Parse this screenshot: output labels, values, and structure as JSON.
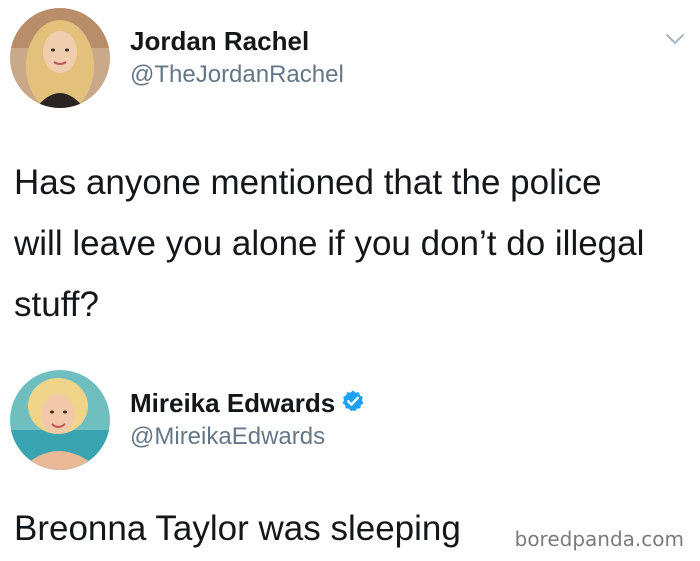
{
  "tweet": {
    "author": {
      "display_name": "Jordan Rachel",
      "handle": "@TheJordanRachel",
      "avatar_icon": "avatar-photo-blonde-woman"
    },
    "text": "Has anyone mentioned that the police will leave you alone if you don’t do illegal stuff?",
    "menu_icon": "chevron-down-icon"
  },
  "reply": {
    "author": {
      "display_name": "Mireika Edwards",
      "handle": "@MireikaEdwards",
      "verified": true,
      "verified_color": "#1da1f2",
      "avatar_icon": "avatar-photo-blonde-woman-pool"
    },
    "text": "Breonna Taylor was sleeping"
  },
  "watermark": "boredpanda.com"
}
